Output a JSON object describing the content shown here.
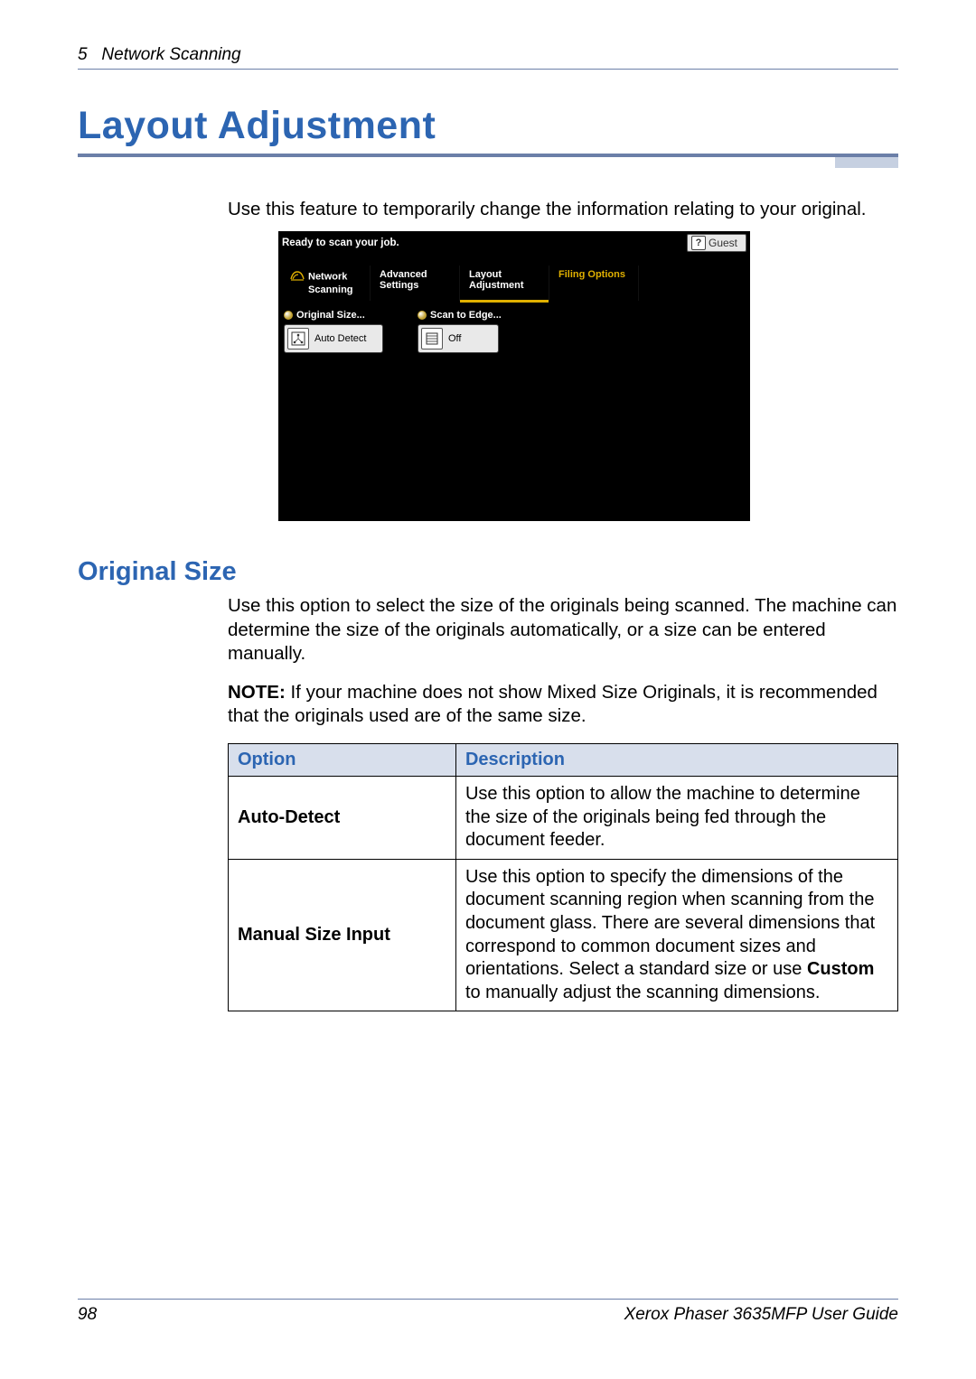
{
  "header": {
    "chapter_num": "5",
    "chapter_title": "Network Scanning"
  },
  "title": "Layout Adjustment",
  "intro": "Use this feature to temporarily change the information relating to your original.",
  "ui": {
    "status_left": "Ready to scan your job.",
    "status_right": "Guest",
    "tabs": [
      {
        "line1": "Network",
        "line2": "Scanning",
        "active": false,
        "icon": "scan"
      },
      {
        "line1": "Advanced",
        "line2": "Settings",
        "active": false
      },
      {
        "line1": "Layout",
        "line2": "Adjustment",
        "active": true
      },
      {
        "line1": "Filing Options",
        "line2": "",
        "active": false
      }
    ],
    "groups": [
      {
        "label": "Original Size...",
        "button_text": "Auto Detect",
        "icon": "auto-detect"
      },
      {
        "label": "Scan to Edge...",
        "button_text": "Off",
        "icon": "scan-edge"
      }
    ]
  },
  "subsection": {
    "title": "Original Size",
    "para1": "Use this option to select the size of the originals being scanned. The machine can determine the size of the originals automatically, or a size can be entered manually.",
    "note_label": "NOTE:",
    "note_text": " If your machine does not show Mixed Size Originals, it is recommended that the originals used are of the same size."
  },
  "table": {
    "headers": {
      "option": "Option",
      "description": "Description"
    },
    "rows": [
      {
        "option": "Auto-Detect",
        "description_plain": "Use this option to allow the machine to determine the size of the originals being fed through the document feeder."
      },
      {
        "option": "Manual Size Input",
        "description_pre": "Use this option to specify the dimensions of the document scanning region when scanning from the document glass. There are several dimensions that correspond to common document sizes and orientations. Select a standard size or use ",
        "description_bold": "Custom",
        "description_post": " to manually adjust the scanning dimensions."
      }
    ]
  },
  "footer": {
    "page_num": "98",
    "doc_title": "Xerox Phaser 3635MFP User Guide"
  }
}
